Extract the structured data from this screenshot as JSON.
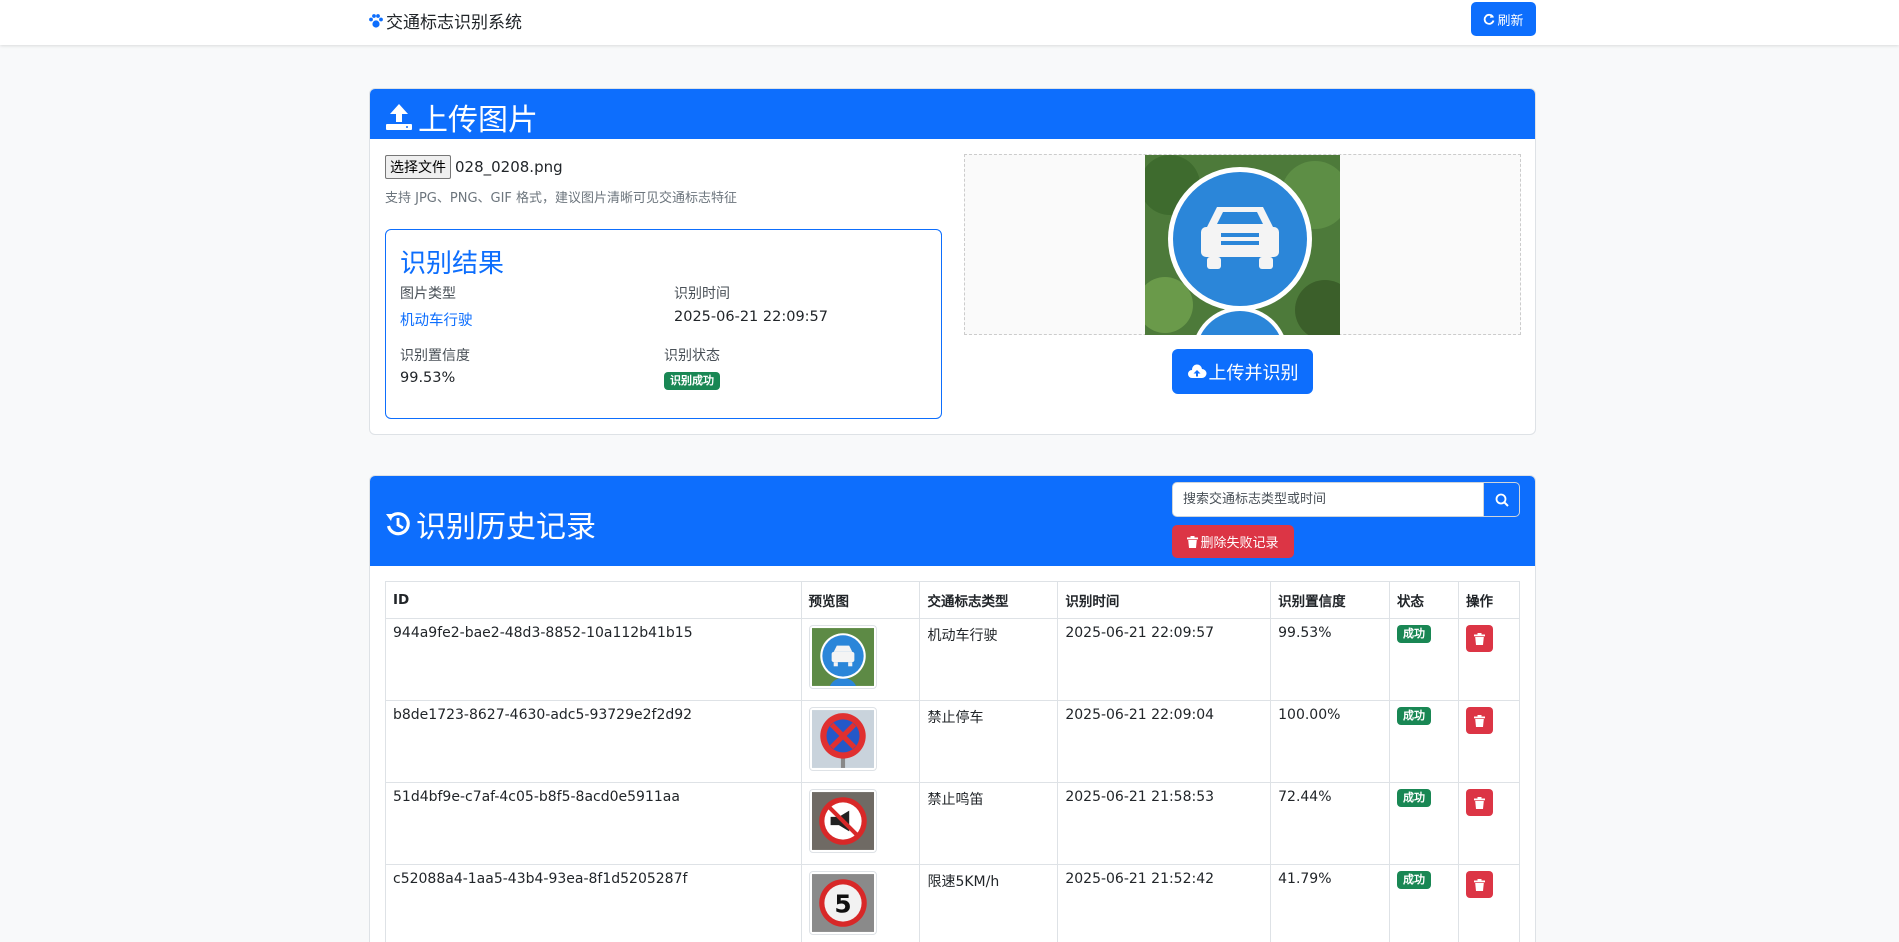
{
  "navbar": {
    "brand": "交通标志识别系统",
    "refresh_label": "刷新"
  },
  "upload": {
    "title": "上传图片",
    "file_button": "选择文件",
    "file_name": "028_0208.png",
    "hint": "支持 JPG、PNG、GIF 格式，建议图片清晰可见交通标志特征",
    "upload_button": "上传并识别"
  },
  "result": {
    "title": "识别结果",
    "type_label": "图片类型",
    "type_value": "机动车行驶",
    "time_label": "识别时间",
    "time_value": "2025-06-21 22:09:57",
    "confidence_label": "识别置信度",
    "confidence_value": "99.53%",
    "status_label": "识别状态",
    "status_value": "识别成功"
  },
  "history": {
    "title": "识别历史记录",
    "search_placeholder": "搜索交通标志类型或时间",
    "delete_failed_label": "删除失败记录",
    "columns": [
      "ID",
      "预览图",
      "交通标志类型",
      "识别时间",
      "识别置信度",
      "状态",
      "操作"
    ],
    "rows": [
      {
        "id": "944a9fe2-bae2-48d3-8852-10a112b41b15",
        "type": "机动车行驶",
        "time": "2025-06-21 22:09:57",
        "confidence": "99.53%",
        "status": "成功",
        "icon": "blue-car-sign"
      },
      {
        "id": "b8de1723-8627-4630-adc5-93729e2f2d92",
        "type": "禁止停车",
        "time": "2025-06-21 22:09:04",
        "confidence": "100.00%",
        "status": "成功",
        "icon": "no-parking-sign"
      },
      {
        "id": "51d4bf9e-c7af-4c05-b8f5-8acd0e5911aa",
        "type": "禁止鸣笛",
        "time": "2025-06-21 21:58:53",
        "confidence": "72.44%",
        "status": "成功",
        "icon": "no-horn-sign"
      },
      {
        "id": "c52088a4-1aa5-43b4-93ea-8f1d5205287f",
        "type": "限速5KM/h",
        "time": "2025-06-21 21:52:42",
        "confidence": "41.79%",
        "status": "成功",
        "icon": "speed-limit-sign",
        "limit_digit": "5"
      }
    ]
  },
  "colors": {
    "primary": "#0d6efd",
    "danger": "#dc3545",
    "success": "#198754"
  }
}
